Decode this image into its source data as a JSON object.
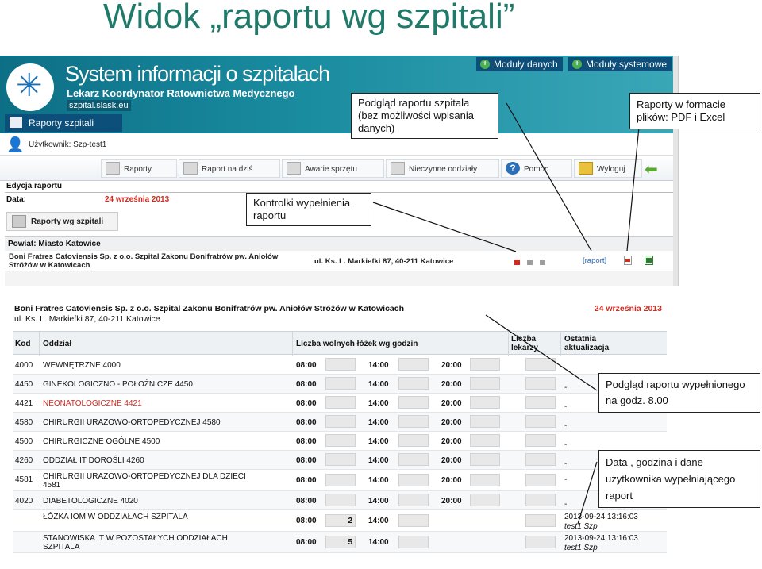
{
  "slide": {
    "title": "Widok „raportu wg szpitali”"
  },
  "app": {
    "title": "System informacji o szpitalach",
    "subtitle": "Lekarz Koordynator Ratownictwa Medycznego",
    "site": "szpital.slask.eu",
    "reports_tab": "Raporty szpitali",
    "buttons": {
      "modules_data": "Moduły danych",
      "modules_system": "Moduły systemowe"
    },
    "user_label": "Użytkownik: Szp-test1",
    "menu": [
      {
        "label": "Raporty",
        "icon": "report-icon"
      },
      {
        "label": "Raport na dziś",
        "icon": "report-today-icon"
      },
      {
        "label": "Awarie sprzętu",
        "icon": "equipment-icon"
      },
      {
        "label": "Nieczynne oddziały",
        "icon": "closed-ward-icon"
      },
      {
        "label": "Pomoc",
        "icon": "help-icon"
      },
      {
        "label": "Wyloguj",
        "icon": "lock-icon"
      }
    ],
    "edit_title": "Edycja raportu",
    "date_label": "Data:",
    "date_value": "24 września 2013",
    "report_button": "Raporty wg szpitali",
    "powiat": "Powiat: Miasto Katowice",
    "hospital_name": "Boni Fratres Catoviensis Sp. z o.o. Szpital Zakonu Bonifratrów pw. Aniołów Stróżów w Katowicach",
    "hospital_address": "ul. Ks. L. Markiefki 87, 40-211 Katowice",
    "report_link": "[raport]",
    "colors": {
      "status_red": "#d12b1f",
      "status_grey": "#9e9e9e",
      "banner": "#0d6f86"
    }
  },
  "report": {
    "hospital_name": "Boni Fratres Catoviensis Sp. z o.o. Szpital Zakonu Bonifratrów pw. Aniołów Stróżów w Katowicach",
    "address": "ul. Ks. L. Markiefki 87, 40-211 Katowice",
    "date": "24 września 2013",
    "columns": {
      "code": "Kod",
      "ward": "Oddział",
      "free_beds": "Liczba wolnych łóżek wg godzin",
      "doctors_1": "Liczba",
      "doctors_2": "lekarzy",
      "updated_1": "Ostatnia",
      "updated_2": "aktualizacja"
    },
    "rows": [
      {
        "code": "4000",
        "ward": "WEWNĘTRZNE 4000",
        "t1": "08:00",
        "t2": "14:00",
        "t3": "20:00",
        "v1": "",
        "updated": "",
        "updated_user": ""
      },
      {
        "code": "4450",
        "ward": "GINEKOLOGICZNO - POŁOŻNICZE 4450",
        "t1": "08:00",
        "t2": "14:00",
        "t3": "20:00",
        "v1": "",
        "updated": "-",
        "updated_user": ""
      },
      {
        "code": "4421",
        "ward": "NEONATOLOGICZNE 4421",
        "t1": "08:00",
        "t2": "14:00",
        "t3": "20:00",
        "v1": "",
        "updated": "-",
        "updated_user": ""
      },
      {
        "code": "4580",
        "ward": "CHIRURGII URAZOWO-ORTOPEDYCZNEJ 4580",
        "t1": "08:00",
        "t2": "14:00",
        "t3": "20:00",
        "v1": "",
        "updated": "-",
        "updated_user": ""
      },
      {
        "code": "4500",
        "ward": "CHIRURGICZNE OGÓLNE 4500",
        "t1": "08:00",
        "t2": "14:00",
        "t3": "20:00",
        "v1": "",
        "updated": "-",
        "updated_user": ""
      },
      {
        "code": "4260",
        "ward": "ODDZIAŁ IT DOROŚLI 4260",
        "t1": "08:00",
        "t2": "14:00",
        "t3": "20:00",
        "v1": "",
        "updated": "-",
        "updated_user": ""
      },
      {
        "code": "4581",
        "ward": "CHIRURGII URAZOWO-ORTOPEDYCZNEJ DLA DZIECI",
        "ward2": "4581",
        "t1": "08:00",
        "t2": "14:00",
        "t3": "20:00",
        "v1": "",
        "updated": "-",
        "updated_user": ""
      },
      {
        "code": "4020",
        "ward": "DIABETOLOGICZNE 4020",
        "t1": "08:00",
        "t2": "14:00",
        "t3": "20:00",
        "v1": "",
        "updated": "-",
        "updated_user": ""
      },
      {
        "code": "",
        "ward": "ŁÓŻKA IOM W ODDZIAŁACH SZPITALA",
        "t1": "08:00",
        "t2": "14:00",
        "t3": "",
        "v1": "2",
        "updated": "2013-09-24 13:16:03",
        "updated_user": "test1 Szp"
      },
      {
        "code": "",
        "ward": "STANOWISKA IT W POZOSTAŁYCH ODDZIAŁACH",
        "ward2": "SZPITALA",
        "t1": "08:00",
        "t2": "14:00",
        "t3": "",
        "v1": "5",
        "updated": "2013-09-24 13:16:03",
        "updated_user": "test1 Szp"
      }
    ]
  },
  "callouts": {
    "preview": "Podgląd raportu szpitala (bez możliwości wpisania danych)",
    "formats": "Raporty w formacie plików: PDF i Excel",
    "controls": "Kontrolki wypełnienia raportu",
    "filled": "Podgląd raportu wypełnionego na godz. 8.00",
    "datauser": "Data , godzina i dane użytkownika wypełniającego raport"
  }
}
